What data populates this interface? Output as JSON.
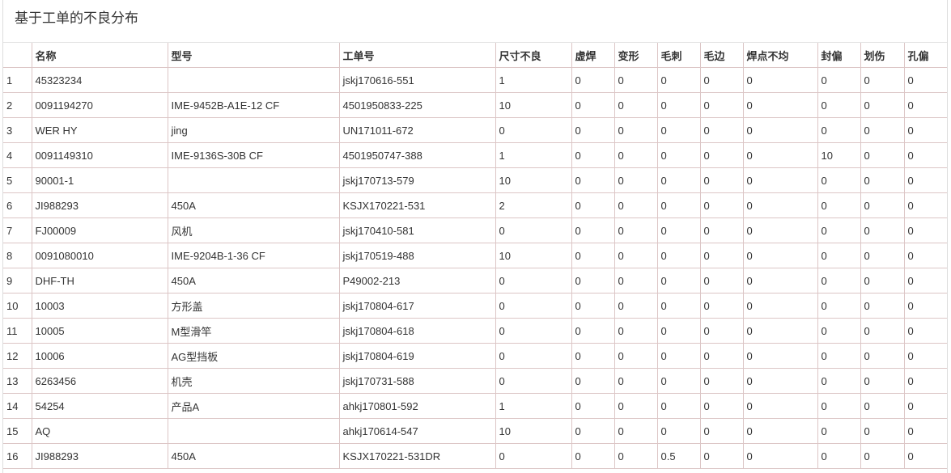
{
  "title": "基于工单的不良分布",
  "columns": [
    "",
    "名称",
    "型号",
    "工单号",
    "尺寸不良",
    "虚焊",
    "变形",
    "毛刺",
    "毛边",
    "焊点不均",
    "封偏",
    "划伤",
    "孔偏"
  ],
  "rows": [
    [
      "1",
      "45323234",
      "",
      "jskj170616-551",
      "1",
      "0",
      "0",
      "0",
      "0",
      "0",
      "0",
      "0",
      "0"
    ],
    [
      "2",
      "0091194270",
      "IME-9452B-A1E-12 CF",
      "4501950833-225",
      "10",
      "0",
      "0",
      "0",
      "0",
      "0",
      "0",
      "0",
      "0"
    ],
    [
      "3",
      "WER HY",
      "jing",
      "UN171011-672",
      "0",
      "0",
      "0",
      "0",
      "0",
      "0",
      "0",
      "0",
      "0"
    ],
    [
      "4",
      "0091149310",
      "IME-9136S-30B CF",
      "4501950747-388",
      "1",
      "0",
      "0",
      "0",
      "0",
      "0",
      "10",
      "0",
      "0"
    ],
    [
      "5",
      "90001-1",
      "",
      "jskj170713-579",
      "10",
      "0",
      "0",
      "0",
      "0",
      "0",
      "0",
      "0",
      "0"
    ],
    [
      "6",
      "JI988293",
      "450A",
      "KSJX170221-531",
      "2",
      "0",
      "0",
      "0",
      "0",
      "0",
      "0",
      "0",
      "0"
    ],
    [
      "7",
      "FJ00009",
      "风机",
      "jskj170410-581",
      "0",
      "0",
      "0",
      "0",
      "0",
      "0",
      "0",
      "0",
      "0"
    ],
    [
      "8",
      "0091080010",
      "IME-9204B-1-36 CF",
      "jskj170519-488",
      "10",
      "0",
      "0",
      "0",
      "0",
      "0",
      "0",
      "0",
      "0"
    ],
    [
      "9",
      "DHF-TH",
      "450A",
      "P49002-213",
      "0",
      "0",
      "0",
      "0",
      "0",
      "0",
      "0",
      "0",
      "0"
    ],
    [
      "10",
      "10003",
      "方形盖",
      "jskj170804-617",
      "0",
      "0",
      "0",
      "0",
      "0",
      "0",
      "0",
      "0",
      "0"
    ],
    [
      "11",
      "10005",
      "M型滑竿",
      "jskj170804-618",
      "0",
      "0",
      "0",
      "0",
      "0",
      "0",
      "0",
      "0",
      "0"
    ],
    [
      "12",
      "10006",
      "AG型挡板",
      "jskj170804-619",
      "0",
      "0",
      "0",
      "0",
      "0",
      "0",
      "0",
      "0",
      "0"
    ],
    [
      "13",
      "6263456",
      "机壳",
      "jskj170731-588",
      "0",
      "0",
      "0",
      "0",
      "0",
      "0",
      "0",
      "0",
      "0"
    ],
    [
      "14",
      "54254",
      "产品A",
      "ahkj170801-592",
      "1",
      "0",
      "0",
      "0",
      "0",
      "0",
      "0",
      "0",
      "0"
    ],
    [
      "15",
      "AQ",
      "",
      "ahkj170614-547",
      "10",
      "0",
      "0",
      "0",
      "0",
      "0",
      "0",
      "0",
      "0"
    ],
    [
      "16",
      "JI988293",
      "450A",
      "KSJX170221-531DR",
      "0",
      "0",
      "0",
      "0.5",
      "0",
      "0",
      "0",
      "0",
      "0"
    ]
  ]
}
